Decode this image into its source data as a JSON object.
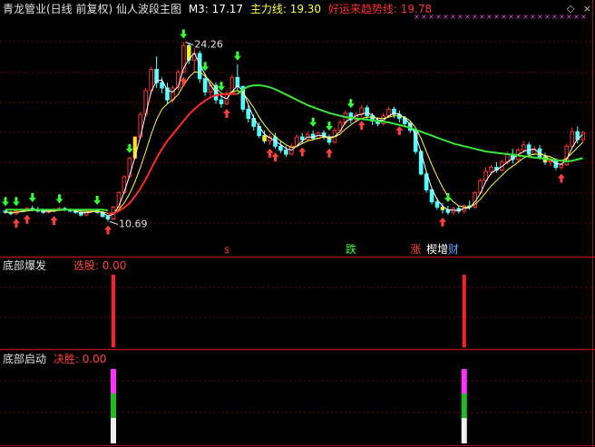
{
  "header": {
    "title": "青龙管业(日线 前复权) 仙人波段主图",
    "m3": "M3: 17.17",
    "main_force": "主力线: 19.30",
    "good_luck": "好运来趋势线: 19.78"
  },
  "icons": {
    "diamond": "◇",
    "close": "×"
  },
  "panel2": {
    "title": "底部爆发",
    "value": "选股: 0.00"
  },
  "panel3": {
    "title": "底部启动",
    "value": "决胜: 0.00"
  },
  "colors": {
    "up": "#ff3232",
    "down": "#54ffff",
    "ma_white": "#ffffff",
    "ma_yellow": "#e6e64a",
    "ma_red": "#ff2a2a",
    "ma_green": "#3ae63a",
    "magenta": "#ff44ff",
    "arrow_green": "#33ff33",
    "arrow_red": "#ff4040"
  },
  "chart_data": [
    {
      "type": "candlestick",
      "title": "仙人波段主图",
      "annotations": [
        {
          "text": "24.26",
          "kind": "high"
        },
        {
          "text": "10.69",
          "kind": "low"
        }
      ],
      "ylim": [
        9.5,
        25.8
      ],
      "candles": [
        [
          11.5,
          11.6,
          11.3,
          11.4
        ],
        [
          11.4,
          11.5,
          11.2,
          11.3
        ],
        [
          11.3,
          11.6,
          11.2,
          11.5
        ],
        [
          11.5,
          11.7,
          11.4,
          11.6
        ],
        [
          11.6,
          11.8,
          11.5,
          11.7
        ],
        [
          11.7,
          11.9,
          11.5,
          11.6
        ],
        [
          11.6,
          11.8,
          11.4,
          11.5
        ],
        [
          11.5,
          11.7,
          11.3,
          11.4
        ],
        [
          11.4,
          11.6,
          11.3,
          11.5
        ],
        [
          11.5,
          11.7,
          11.4,
          11.6
        ],
        [
          11.6,
          11.8,
          11.5,
          11.7
        ],
        [
          11.7,
          11.8,
          11.5,
          11.6
        ],
        [
          11.6,
          11.7,
          11.4,
          11.5
        ],
        [
          11.5,
          11.6,
          11.3,
          11.4
        ],
        [
          11.4,
          11.5,
          11.1,
          11.2
        ],
        [
          11.2,
          11.6,
          11.1,
          11.5
        ],
        [
          11.5,
          11.7,
          11.4,
          11.6
        ],
        [
          11.6,
          11.7,
          11.3,
          11.4
        ],
        [
          11.4,
          11.5,
          11.0,
          11.1
        ],
        [
          11.1,
          11.2,
          10.7,
          10.9
        ],
        [
          10.9,
          11.9,
          10.8,
          11.8
        ],
        [
          11.8,
          13.0,
          11.7,
          12.9
        ],
        [
          12.9,
          14.2,
          12.8,
          14.1
        ],
        [
          14.1,
          15.6,
          14.0,
          15.5
        ],
        [
          15.5,
          17.2,
          15.4,
          17.1
        ],
        [
          17.1,
          19.0,
          17.0,
          18.8
        ],
        [
          18.8,
          20.8,
          18.6,
          20.6
        ],
        [
          20.6,
          22.4,
          20.3,
          22.2
        ],
        [
          22.2,
          23.2,
          20.8,
          21.2
        ],
        [
          21.2,
          21.6,
          20.4,
          20.8
        ],
        [
          20.8,
          21.2,
          19.6,
          19.9
        ],
        [
          19.9,
          21.0,
          19.7,
          20.8
        ],
        [
          20.8,
          22.2,
          20.6,
          22.0
        ],
        [
          22.0,
          24.26,
          21.9,
          24.0
        ],
        [
          24.0,
          24.2,
          22.6,
          22.9
        ],
        [
          22.9,
          23.8,
          22.0,
          23.4
        ],
        [
          23.4,
          23.6,
          21.2,
          21.5
        ],
        [
          21.5,
          21.8,
          20.2,
          20.5
        ],
        [
          20.5,
          21.3,
          20.2,
          21.0
        ],
        [
          21.0,
          21.2,
          19.6,
          19.9
        ],
        [
          19.9,
          20.3,
          19.3,
          19.6
        ],
        [
          19.6,
          20.6,
          19.5,
          20.4
        ],
        [
          20.4,
          21.8,
          20.3,
          21.6
        ],
        [
          21.6,
          22.6,
          20.6,
          20.9
        ],
        [
          20.9,
          21.0,
          19.0,
          19.2
        ],
        [
          19.2,
          19.5,
          18.2,
          18.5
        ],
        [
          18.5,
          18.8,
          17.6,
          17.9
        ],
        [
          17.9,
          18.2,
          17.0,
          17.2
        ],
        [
          17.2,
          17.6,
          16.6,
          16.8
        ],
        [
          16.8,
          17.3,
          16.5,
          17.1
        ],
        [
          17.1,
          17.4,
          16.2,
          16.4
        ],
        [
          16.4,
          16.8,
          15.9,
          16.1
        ],
        [
          16.1,
          16.4,
          15.6,
          15.8
        ],
        [
          15.8,
          16.6,
          15.7,
          16.4
        ],
        [
          16.4,
          17.3,
          16.3,
          17.1
        ],
        [
          17.1,
          17.4,
          16.6,
          16.9
        ],
        [
          16.9,
          17.5,
          16.8,
          17.3
        ],
        [
          17.3,
          17.6,
          16.8,
          17.0
        ],
        [
          17.0,
          17.5,
          16.9,
          17.4
        ],
        [
          17.4,
          17.6,
          16.9,
          17.1
        ],
        [
          17.1,
          17.3,
          16.5,
          16.7
        ],
        [
          16.7,
          17.8,
          16.6,
          17.6
        ],
        [
          17.6,
          18.4,
          17.5,
          18.2
        ],
        [
          18.2,
          19.1,
          18.0,
          18.9
        ],
        [
          18.9,
          19.0,
          18.1,
          18.4
        ],
        [
          18.4,
          19.0,
          18.2,
          18.8
        ],
        [
          18.8,
          19.5,
          18.6,
          19.3
        ],
        [
          19.3,
          19.5,
          18.4,
          18.7
        ],
        [
          18.7,
          18.9,
          18.0,
          18.3
        ],
        [
          18.3,
          18.6,
          17.9,
          18.1
        ],
        [
          18.1,
          18.9,
          18.0,
          18.7
        ],
        [
          18.7,
          19.4,
          18.6,
          19.2
        ],
        [
          19.2,
          19.4,
          18.5,
          18.8
        ],
        [
          18.8,
          19.1,
          18.2,
          18.5
        ],
        [
          18.5,
          18.7,
          17.9,
          18.1
        ],
        [
          18.1,
          18.3,
          17.4,
          17.6
        ],
        [
          17.6,
          17.7,
          15.8,
          16.0
        ],
        [
          16.0,
          16.1,
          14.2,
          14.3
        ],
        [
          14.3,
          14.5,
          12.9,
          13.1
        ],
        [
          13.1,
          13.3,
          12.0,
          12.2
        ],
        [
          12.2,
          12.5,
          11.6,
          11.8
        ],
        [
          11.8,
          12.1,
          11.3,
          11.6
        ],
        [
          11.6,
          11.9,
          11.2,
          11.4
        ],
        [
          11.4,
          11.8,
          11.2,
          11.7
        ],
        [
          11.7,
          11.9,
          11.3,
          11.5
        ],
        [
          11.5,
          12.0,
          11.3,
          11.9
        ],
        [
          11.9,
          12.3,
          11.6,
          11.8
        ],
        [
          11.8,
          13.0,
          11.7,
          12.9
        ],
        [
          12.9,
          14.0,
          12.8,
          13.8
        ],
        [
          13.8,
          14.8,
          13.6,
          14.5
        ],
        [
          14.5,
          15.0,
          14.2,
          14.8
        ],
        [
          14.8,
          15.2,
          14.4,
          14.6
        ],
        [
          14.6,
          15.4,
          14.5,
          15.2
        ],
        [
          15.2,
          16.0,
          15.0,
          15.8
        ],
        [
          15.8,
          16.2,
          15.1,
          15.4
        ],
        [
          15.4,
          16.3,
          15.2,
          16.1
        ],
        [
          16.1,
          16.8,
          15.9,
          16.5
        ],
        [
          16.5,
          16.7,
          15.6,
          15.8
        ],
        [
          15.8,
          16.4,
          15.7,
          16.2
        ],
        [
          16.2,
          16.5,
          15.4,
          15.6
        ],
        [
          15.6,
          15.9,
          15.0,
          15.2
        ],
        [
          15.2,
          15.6,
          14.9,
          15.3
        ],
        [
          15.3,
          15.5,
          14.6,
          14.8
        ],
        [
          14.8,
          15.1,
          14.6,
          15.0
        ],
        [
          15.0,
          16.6,
          14.9,
          16.4
        ],
        [
          16.4,
          17.8,
          16.3,
          17.5
        ],
        [
          17.5,
          17.9,
          16.6,
          16.9
        ],
        [
          16.9,
          17.6,
          16.7,
          17.4
        ]
      ],
      "series": [
        {
          "name": "M3",
          "color": "#ffffff",
          "values": [
            11.43,
            11.4,
            11.4,
            11.47,
            11.6,
            11.67,
            11.6,
            11.5,
            11.47,
            11.5,
            11.6,
            11.63,
            11.6,
            11.5,
            11.37,
            11.37,
            11.43,
            11.5,
            11.37,
            11.13,
            11.27,
            11.87,
            12.93,
            14.17,
            15.57,
            17.13,
            18.83,
            20.53,
            21.33,
            21.4,
            20.63,
            20.5,
            20.9,
            22.27,
            22.97,
            23.43,
            22.6,
            21.8,
            21.0,
            20.47,
            20.17,
            19.97,
            20.53,
            20.97,
            20.57,
            19.53,
            18.53,
            17.87,
            17.3,
            17.03,
            16.77,
            16.53,
            16.23,
            16.1,
            16.43,
            16.8,
            17.1,
            17.07,
            17.23,
            17.17,
            17.07,
            17.13,
            17.5,
            18.23,
            18.5,
            18.7,
            18.83,
            18.93,
            18.77,
            18.37,
            18.37,
            18.67,
            18.9,
            18.83,
            18.47,
            18.07,
            17.23,
            15.97,
            14.47,
            13.2,
            12.37,
            11.87,
            11.6,
            11.57,
            11.53,
            11.7,
            11.73,
            12.2,
            12.83,
            13.73,
            14.37,
            14.63,
            14.87,
            15.2,
            15.47,
            15.77,
            16.0,
            16.13,
            16.17,
            15.87,
            15.67,
            15.37,
            15.1,
            15.03,
            15.4,
            16.3,
            16.93,
            17.27
          ]
        },
        {
          "name": "主力线",
          "color": "#ffff40",
          "values": [
            11.4,
            11.4,
            11.42,
            11.45,
            11.5,
            11.55,
            11.56,
            11.55,
            11.53,
            11.53,
            11.55,
            11.58,
            11.58,
            11.56,
            11.5,
            11.47,
            11.47,
            11.47,
            11.43,
            11.33,
            11.35,
            11.6,
            12.1,
            12.8,
            13.7,
            14.8,
            16.0,
            17.3,
            18.4,
            19.2,
            19.6,
            19.9,
            20.3,
            21.0,
            21.6,
            22.0,
            22.0,
            21.7,
            21.3,
            20.8,
            20.4,
            20.3,
            20.5,
            20.6,
            20.4,
            19.9,
            19.3,
            18.6,
            18.0,
            17.5,
            17.1,
            16.8,
            16.5,
            16.3,
            16.4,
            16.6,
            16.8,
            16.9,
            17.0,
            17.1,
            17.0,
            17.1,
            17.3,
            17.7,
            18.0,
            18.3,
            18.5,
            18.6,
            18.6,
            18.5,
            18.5,
            18.6,
            18.7,
            18.7,
            18.6,
            18.3,
            17.8,
            17.0,
            16.0,
            15.0,
            14.1,
            13.3,
            12.6,
            12.2,
            11.9,
            11.8,
            11.8,
            12.0,
            12.4,
            12.9,
            13.4,
            13.8,
            14.2,
            14.6,
            14.9,
            15.2,
            15.5,
            15.7,
            15.8,
            15.8,
            15.7,
            15.6,
            15.4,
            15.3,
            15.5,
            15.9,
            16.3,
            16.7
          ]
        },
        {
          "name": "好运来趋势线",
          "color": "#ff2a2a",
          "values": [
            null,
            null,
            null,
            null,
            null,
            null,
            null,
            null,
            null,
            null,
            null,
            null,
            null,
            null,
            null,
            null,
            null,
            null,
            null,
            11.3,
            11.35,
            11.5,
            11.75,
            12.1,
            12.6,
            13.2,
            13.9,
            14.7,
            15.5,
            16.2,
            16.8,
            17.3,
            17.8,
            18.3,
            18.8,
            19.2,
            19.55,
            19.85,
            20.1,
            20.25,
            20.3,
            20.33,
            20.35,
            20.35
          ]
        },
        {
          "name": "趋势",
          "color": "#3ae63a",
          "values": [
            11.6,
            11.6,
            11.6,
            11.6,
            11.6,
            11.6,
            11.6,
            11.6,
            11.6,
            11.6,
            11.6,
            11.6,
            11.6,
            11.6,
            11.6,
            11.6,
            11.6,
            11.6,
            11.6,
            11.55,
            null,
            null,
            null,
            null,
            null,
            null,
            null,
            null,
            null,
            null,
            null,
            null,
            null,
            null,
            null,
            null,
            null,
            null,
            null,
            null,
            null,
            null,
            null,
            20.35,
            20.7,
            20.9,
            21.0,
            21.0,
            20.95,
            20.85,
            20.7,
            20.5,
            20.3,
            20.1,
            19.9,
            19.7,
            19.5,
            19.35,
            19.2,
            19.05,
            18.9,
            18.8,
            18.7,
            18.6,
            18.55,
            18.5,
            18.45,
            18.4,
            18.35,
            18.3,
            18.25,
            18.2,
            18.1,
            18.0,
            17.9,
            17.8,
            17.65,
            17.5,
            17.35,
            17.2,
            17.05,
            16.9,
            16.75,
            16.6,
            16.5,
            16.4,
            16.3,
            16.2,
            16.1,
            16.0,
            15.95,
            15.9,
            15.85,
            15.8,
            15.75,
            15.7,
            15.65,
            15.6,
            15.55,
            15.5,
            15.45,
            15.4,
            15.35,
            15.3,
            15.25,
            15.3,
            15.4,
            15.5
          ]
        }
      ],
      "yellow_bars": [
        9,
        24,
        34,
        48,
        81,
        100
      ],
      "up_arrows": [
        2,
        4,
        9,
        19,
        33,
        41,
        49,
        50,
        55,
        60,
        66,
        73,
        81,
        103
      ],
      "down_arrows": [
        0,
        2,
        5,
        10,
        17,
        23,
        33,
        37,
        40,
        43,
        57,
        60,
        64,
        82
      ],
      "markers": [
        {
          "text": "跌",
          "index": 63,
          "color": "#33ff33"
        },
        {
          "text": "涨",
          "index": 75,
          "color": "#ff4040"
        },
        {
          "text": "楔增",
          "index": 78,
          "color": "#ffffff"
        },
        {
          "text": "财",
          "index": 82,
          "color": "#4aa8ff"
        }
      ],
      "dollar_index": 41
    },
    {
      "type": "bar",
      "title": "底部爆发",
      "series": [
        {
          "name": "选股",
          "values": [
            {
              "index": 20,
              "value": 1
            },
            {
              "index": 85,
              "value": 1
            }
          ]
        }
      ]
    },
    {
      "type": "bar",
      "title": "底部启动",
      "series": [
        {
          "name": "决胜",
          "values": [
            {
              "index": 20,
              "value": 1
            },
            {
              "index": 85,
              "value": 1
            }
          ]
        }
      ]
    }
  ]
}
